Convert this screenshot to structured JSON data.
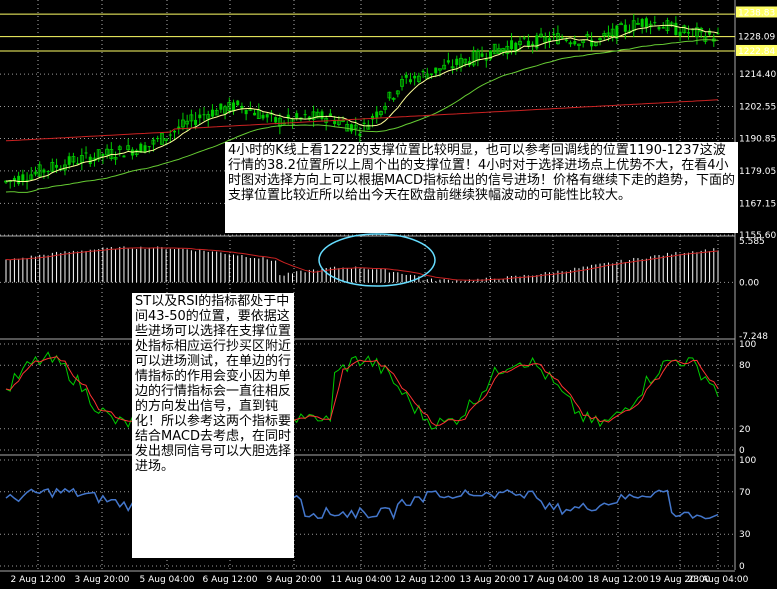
{
  "chart_data": [
    {
      "type": "candlestick",
      "panel": "price",
      "price_tags": {
        "top": "1238.83",
        "ask": "1228.09",
        "bid": "1222.84"
      },
      "yticks": [
        "1214.40",
        "1202.55",
        "1190.85",
        "1179.05",
        "1167.15",
        "1155.60"
      ],
      "ylim": [
        1155.6,
        1240
      ],
      "horizontal_lines": [
        1236.3,
        1228.09,
        1222.84
      ],
      "ma_fast_desc": "yellow moving average",
      "ma_mid_desc": "green moving average",
      "ma_slow_desc": "red moving average",
      "grid": true
    },
    {
      "type": "histogram",
      "panel": "macd",
      "yticks": [
        "5.585",
        "0.00",
        "-7.248"
      ],
      "ylim": [
        -7.248,
        5.585
      ]
    },
    {
      "type": "line",
      "panel": "stochastic",
      "yticks": [
        "100",
        "80",
        "20",
        "0"
      ],
      "ylim": [
        0,
        100
      ]
    },
    {
      "type": "line",
      "panel": "rsi",
      "yticks": [
        "100",
        "70",
        "30",
        "0"
      ],
      "ylim": [
        0,
        100
      ]
    }
  ],
  "x_labels": [
    "2 Aug 12:00",
    "3 Aug 20:00",
    "5 Aug 04:00",
    "6 Aug 12:00",
    "9 Aug 20:00",
    "11 Aug 04:00",
    "12 Aug 12:00",
    "13 Aug 20:00",
    "17 Aug 04:00",
    "18 Aug 12:00",
    "19 Aug 20:00",
    "23 Aug 04:00"
  ],
  "notes": {
    "note1": "4小时的K线上看1222的支撑位置比较明显，也可以参考回调线的位置1190-1237这波行情的38.2位置所以上周个出的支撑位置！4小时对于选择进场点上优势不大，在看4小时图对选择方向上可以根据MACD指标给出的信号进场！价格有继续下走的趋势，下面的支撑位置比较近所以给出今天在欧盘前继续狭幅波动的可能性比较大。",
    "note2": "ST以及RSI的指标都处于中间43-50的位置，要依据这些进场可以选择在支撑位置处指标相应运行抄买区附近可以进场测试，在单边的行情指标的作用会变小因为单边的行情指标会一直往相反的方向发出信号，直到钝化！所以参考这两个指标要结合MACD去考虑，在同时发出想同信号可以大胆选择进场。"
  },
  "colors": {
    "background": "#000000",
    "candle": "#00cc00",
    "ma_fast": "#ffff99",
    "ma_mid": "#66cc33",
    "ma_slow": "#cc2222",
    "hline": "#ffff66",
    "macd_bar": "#ffffff",
    "macd_signal": "#cc2222",
    "stoch_main": "#00cc00",
    "stoch_signal": "#ff3333",
    "rsi": "#4477cc",
    "circle": "#66ddff",
    "grid": "#ffffff"
  }
}
